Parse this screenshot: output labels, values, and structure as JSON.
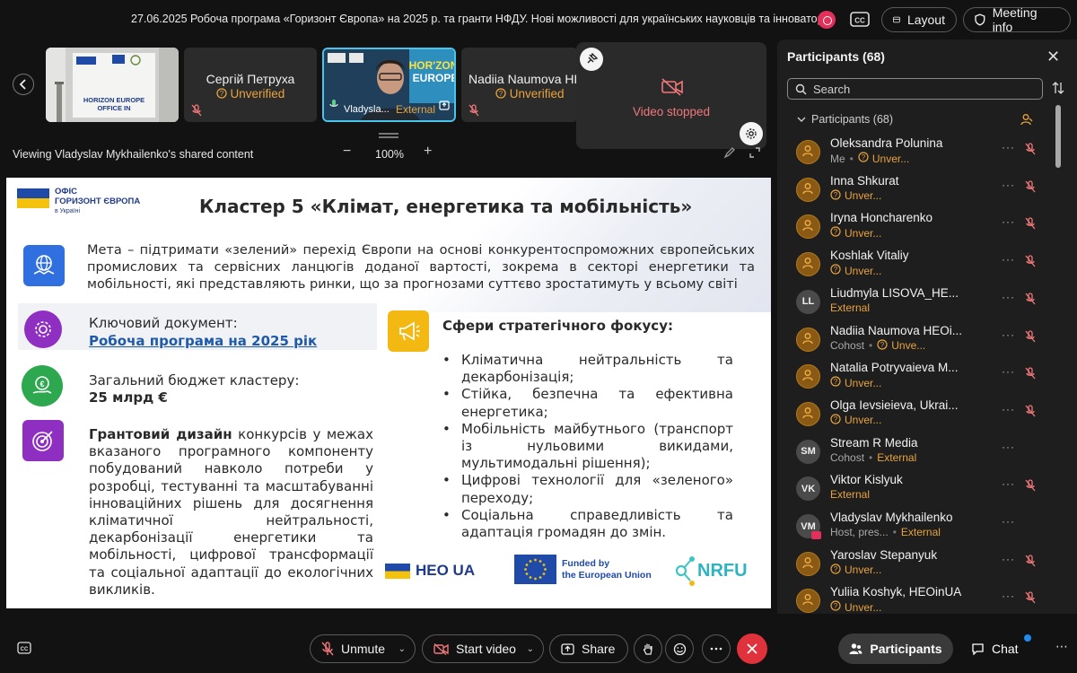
{
  "topbar": {
    "meeting_title": "27.06.2025 Робоча програма «Горизонт Європа» на 2025 р. та гранти НФДУ. Нові можливості для українських науковців та інноваторів",
    "layout_label": "Layout",
    "info_label": "Meeting info"
  },
  "strip": {
    "tile1_caption": "HORIZON EUROPE OFFICE IN",
    "tile2": {
      "name": "Сергій Петруха",
      "status": "Unverified"
    },
    "tile3": {
      "name": "Vladysla...",
      "status": "External"
    },
    "tile4": {
      "name": "Nadiia Naumova HEO",
      "status": "Unverified"
    },
    "video_stopped": "Video stopped"
  },
  "share": {
    "viewing": "Viewing Vladyslav Mykhailenko's shared content",
    "zoom": "100%"
  },
  "slide": {
    "logo_line1": "ОФІС",
    "logo_line2": "ГОРИЗОНТ ЄВРОПА",
    "logo_line3": "в Україні",
    "title": "Кластер 5 «Клімат, енергетика та мобільність»",
    "goal": "Мета – підтримати «зелений» перехід Європи на основі конкурентоспроможних європейських промислових та сервісних ланцюгів доданої вартості, зокрема в секторі енергетики та мобільності, які представляють ринки, що за прогнозами суттєво зростатимуть у всьому світі",
    "key_doc_label": "Ключовий документ:",
    "key_doc_link": "Робоча програма на 2025 рік",
    "budget_label": "Загальний бюджет кластеру:",
    "budget_value": "25 млрд €",
    "grant_bold": "Грантовий дизайн",
    "grant_rest": " конкурсів у межах вказаного програмного компоненту побудований навколо потреби у розробці, тестуванні та масштабуванні інноваційних рішень для досягнення кліматичної нейтральності, декарбонізації енергетики та мобільності, цифрової трансформації та соціальної адаптації до екологічних викликів.",
    "focus_title": "Сфери стратегічного фокусу:",
    "focus_items": [
      "Кліматична нейтральність та декарбонізація;",
      "Стійка, безпечна та ефективна енергетика;",
      "Мобільність майбутнього (транспорт із нульовими викидами, мультимодальні рішення);",
      "Цифрові технології для «зеленого» переходу;",
      "Соціальна справедливість та адаптація громадян до змін."
    ],
    "heo_logo": "HEO UA",
    "eu_line1": "Funded by",
    "eu_line2": "the European Union",
    "nrfu_logo": "NRFU"
  },
  "panel": {
    "title": "Participants (68)",
    "search_placeholder": "Search",
    "section": "Participants (68)",
    "participants": [
      {
        "name": "Oleksandra Polunina",
        "role": "Me",
        "status": "Unver...",
        "avatar": "icon"
      },
      {
        "name": "Inna Shkurat",
        "role": "",
        "status": "Unver...",
        "avatar": "icon"
      },
      {
        "name": "Iryna Honcharenko",
        "role": "",
        "status": "Unver...",
        "avatar": "icon"
      },
      {
        "name": "Koshlak Vitaliy",
        "role": "",
        "status": "Unver...",
        "avatar": "icon"
      },
      {
        "name": "Liudmyla LISOVA_HE...",
        "role": "",
        "status": "External",
        "avatar": "LL"
      },
      {
        "name": "Nadiia Naumova HEOi...",
        "role": "Cohost",
        "status": "Unve...",
        "avatar": "icon"
      },
      {
        "name": "Natalia Potryvaieva M...",
        "role": "",
        "status": "Unver...",
        "avatar": "icon"
      },
      {
        "name": "Olga Ievsieieva, Ukrai...",
        "role": "",
        "status": "Unver...",
        "avatar": "icon"
      },
      {
        "name": "Stream R Media",
        "role": "Cohost",
        "status": "External",
        "avatar": "SM"
      },
      {
        "name": "Viktor Kislyuk",
        "role": "",
        "status": "External",
        "avatar": "VK"
      },
      {
        "name": "Vladyslav Mykhailenko",
        "role": "Host, pres...",
        "status": "External",
        "avatar": "VM"
      },
      {
        "name": "Yaroslav Stepanyuk",
        "role": "",
        "status": "Unver...",
        "avatar": "icon"
      },
      {
        "name": "Yuliia Koshyk, HEOinUA",
        "role": "",
        "status": "Unver...",
        "avatar": "icon"
      }
    ]
  },
  "bottombar": {
    "unmute": "Unmute",
    "start_video": "Start video",
    "share": "Share",
    "participants": "Participants",
    "chat": "Chat"
  },
  "colors": {
    "accent_orange": "#e8a33d",
    "end_red": "#e0323c",
    "record_pink": "#e2305a",
    "stopped_red": "#f0787a"
  }
}
